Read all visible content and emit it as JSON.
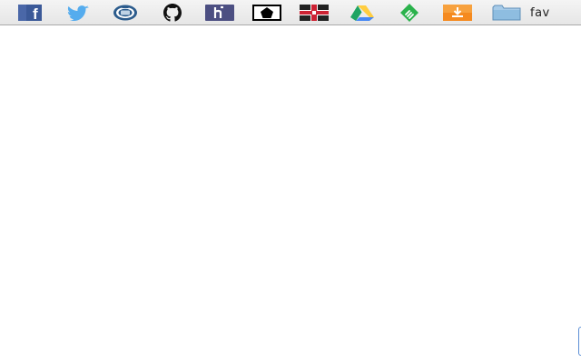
{
  "bookmarks_bar": {
    "items": [
      {
        "icon": "facebook-icon",
        "color": "#3b5998"
      },
      {
        "icon": "twitter-icon",
        "color": "#55acee"
      },
      {
        "icon": "tor-onion-icon",
        "color": "#2b5b8c"
      },
      {
        "icon": "github-icon",
        "color": "#111111"
      },
      {
        "icon": "heroku-icon",
        "color": "#4c4f82"
      },
      {
        "icon": "pentagon-icon",
        "color": "#000000"
      },
      {
        "icon": "crosshair-grid-icon",
        "color": "#cc2233"
      },
      {
        "icon": "google-drive-icon",
        "color": "#1fa463"
      },
      {
        "icon": "feedly-icon",
        "color": "#2bb24c"
      },
      {
        "icon": "download-icon",
        "color": "#f58a1f"
      }
    ],
    "folder": {
      "icon": "folder-icon",
      "label": "fav",
      "color": "#7fb0d8"
    }
  }
}
